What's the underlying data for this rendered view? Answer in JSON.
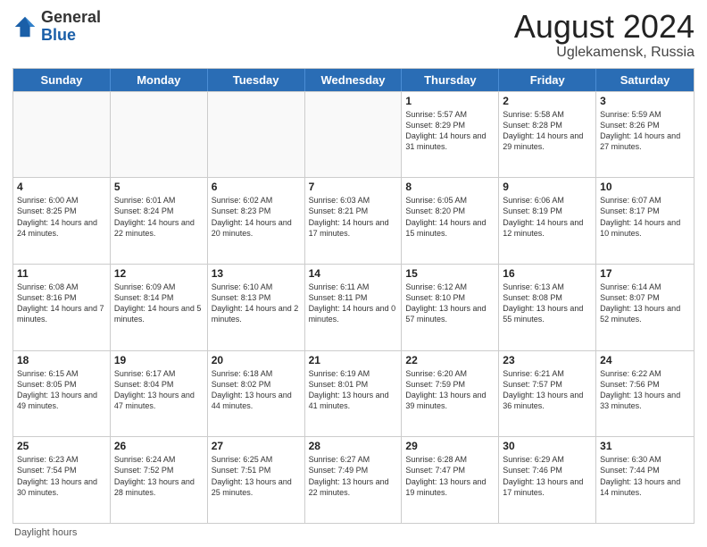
{
  "logo": {
    "general": "General",
    "blue": "Blue"
  },
  "title": "August 2024",
  "subtitle": "Uglekamensk, Russia",
  "days_of_week": [
    "Sunday",
    "Monday",
    "Tuesday",
    "Wednesday",
    "Thursday",
    "Friday",
    "Saturday"
  ],
  "footer": "Daylight hours",
  "weeks": [
    [
      {
        "day": "",
        "sunrise": "",
        "sunset": "",
        "daylight": ""
      },
      {
        "day": "",
        "sunrise": "",
        "sunset": "",
        "daylight": ""
      },
      {
        "day": "",
        "sunrise": "",
        "sunset": "",
        "daylight": ""
      },
      {
        "day": "",
        "sunrise": "",
        "sunset": "",
        "daylight": ""
      },
      {
        "day": "1",
        "sunrise": "5:57 AM",
        "sunset": "8:29 PM",
        "daylight": "14 hours and 31 minutes."
      },
      {
        "day": "2",
        "sunrise": "5:58 AM",
        "sunset": "8:28 PM",
        "daylight": "14 hours and 29 minutes."
      },
      {
        "day": "3",
        "sunrise": "5:59 AM",
        "sunset": "8:26 PM",
        "daylight": "14 hours and 27 minutes."
      }
    ],
    [
      {
        "day": "4",
        "sunrise": "6:00 AM",
        "sunset": "8:25 PM",
        "daylight": "14 hours and 24 minutes."
      },
      {
        "day": "5",
        "sunrise": "6:01 AM",
        "sunset": "8:24 PM",
        "daylight": "14 hours and 22 minutes."
      },
      {
        "day": "6",
        "sunrise": "6:02 AM",
        "sunset": "8:23 PM",
        "daylight": "14 hours and 20 minutes."
      },
      {
        "day": "7",
        "sunrise": "6:03 AM",
        "sunset": "8:21 PM",
        "daylight": "14 hours and 17 minutes."
      },
      {
        "day": "8",
        "sunrise": "6:05 AM",
        "sunset": "8:20 PM",
        "daylight": "14 hours and 15 minutes."
      },
      {
        "day": "9",
        "sunrise": "6:06 AM",
        "sunset": "8:19 PM",
        "daylight": "14 hours and 12 minutes."
      },
      {
        "day": "10",
        "sunrise": "6:07 AM",
        "sunset": "8:17 PM",
        "daylight": "14 hours and 10 minutes."
      }
    ],
    [
      {
        "day": "11",
        "sunrise": "6:08 AM",
        "sunset": "8:16 PM",
        "daylight": "14 hours and 7 minutes."
      },
      {
        "day": "12",
        "sunrise": "6:09 AM",
        "sunset": "8:14 PM",
        "daylight": "14 hours and 5 minutes."
      },
      {
        "day": "13",
        "sunrise": "6:10 AM",
        "sunset": "8:13 PM",
        "daylight": "14 hours and 2 minutes."
      },
      {
        "day": "14",
        "sunrise": "6:11 AM",
        "sunset": "8:11 PM",
        "daylight": "14 hours and 0 minutes."
      },
      {
        "day": "15",
        "sunrise": "6:12 AM",
        "sunset": "8:10 PM",
        "daylight": "13 hours and 57 minutes."
      },
      {
        "day": "16",
        "sunrise": "6:13 AM",
        "sunset": "8:08 PM",
        "daylight": "13 hours and 55 minutes."
      },
      {
        "day": "17",
        "sunrise": "6:14 AM",
        "sunset": "8:07 PM",
        "daylight": "13 hours and 52 minutes."
      }
    ],
    [
      {
        "day": "18",
        "sunrise": "6:15 AM",
        "sunset": "8:05 PM",
        "daylight": "13 hours and 49 minutes."
      },
      {
        "day": "19",
        "sunrise": "6:17 AM",
        "sunset": "8:04 PM",
        "daylight": "13 hours and 47 minutes."
      },
      {
        "day": "20",
        "sunrise": "6:18 AM",
        "sunset": "8:02 PM",
        "daylight": "13 hours and 44 minutes."
      },
      {
        "day": "21",
        "sunrise": "6:19 AM",
        "sunset": "8:01 PM",
        "daylight": "13 hours and 41 minutes."
      },
      {
        "day": "22",
        "sunrise": "6:20 AM",
        "sunset": "7:59 PM",
        "daylight": "13 hours and 39 minutes."
      },
      {
        "day": "23",
        "sunrise": "6:21 AM",
        "sunset": "7:57 PM",
        "daylight": "13 hours and 36 minutes."
      },
      {
        "day": "24",
        "sunrise": "6:22 AM",
        "sunset": "7:56 PM",
        "daylight": "13 hours and 33 minutes."
      }
    ],
    [
      {
        "day": "25",
        "sunrise": "6:23 AM",
        "sunset": "7:54 PM",
        "daylight": "13 hours and 30 minutes."
      },
      {
        "day": "26",
        "sunrise": "6:24 AM",
        "sunset": "7:52 PM",
        "daylight": "13 hours and 28 minutes."
      },
      {
        "day": "27",
        "sunrise": "6:25 AM",
        "sunset": "7:51 PM",
        "daylight": "13 hours and 25 minutes."
      },
      {
        "day": "28",
        "sunrise": "6:27 AM",
        "sunset": "7:49 PM",
        "daylight": "13 hours and 22 minutes."
      },
      {
        "day": "29",
        "sunrise": "6:28 AM",
        "sunset": "7:47 PM",
        "daylight": "13 hours and 19 minutes."
      },
      {
        "day": "30",
        "sunrise": "6:29 AM",
        "sunset": "7:46 PM",
        "daylight": "13 hours and 17 minutes."
      },
      {
        "day": "31",
        "sunrise": "6:30 AM",
        "sunset": "7:44 PM",
        "daylight": "13 hours and 14 minutes."
      }
    ]
  ]
}
